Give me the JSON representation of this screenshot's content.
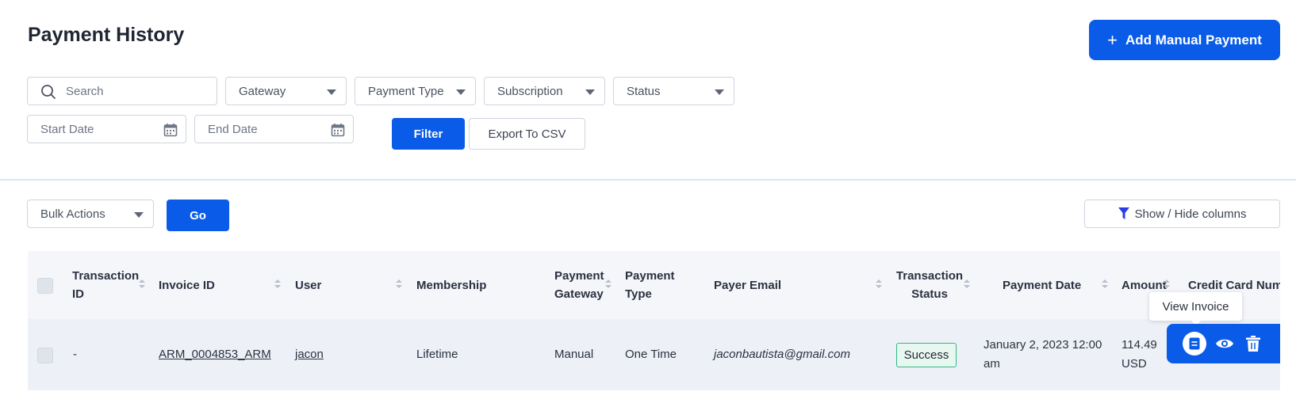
{
  "header": {
    "title": "Payment History",
    "add_button_label": "Add Manual Payment"
  },
  "filters": {
    "search_placeholder": "Search",
    "gateway": "Gateway",
    "payment_type": "Payment Type",
    "subscription": "Subscription",
    "status": "Status",
    "start_date": "Start Date",
    "end_date": "End Date",
    "filter_button": "Filter",
    "export_button": "Export To CSV"
  },
  "toolbar": {
    "bulk_actions": "Bulk Actions",
    "go_button": "Go",
    "show_hide_columns": "Show / Hide columns"
  },
  "table": {
    "columns": {
      "transaction_id": [
        "Transaction",
        "ID"
      ],
      "invoice_id": "Invoice ID",
      "user": "User",
      "membership": "Membership",
      "payment_gateway": [
        "Payment",
        "Gateway"
      ],
      "payment_type": [
        "Payment",
        "Type"
      ],
      "payer_email": "Payer Email",
      "transaction_status": [
        "Transaction",
        "Status"
      ],
      "payment_date": "Payment Date",
      "amount": "Amount",
      "credit_card": "Credit Card Num"
    },
    "rows": [
      {
        "transaction_id": "-",
        "invoice_id": "ARM_0004853_ARM",
        "user": "jacon",
        "membership": "Lifetime",
        "payment_gateway": "Manual",
        "payment_type": "One Time",
        "payer_email": "jaconbautista@gmail.com",
        "transaction_status": "Success",
        "payment_date": [
          "January 2, 2023 12:00",
          "am"
        ],
        "amount": [
          "114.49",
          "USD"
        ]
      }
    ]
  },
  "tooltip": "View Invoice",
  "colors": {
    "primary": "#0a5ce8",
    "success_border": "#2eb886",
    "filter_icon": "#2a3ee6"
  },
  "icons": [
    "search-icon",
    "calendar-icon",
    "plus-icon",
    "funnel-icon",
    "invoice-icon",
    "eye-icon",
    "trash-icon"
  ]
}
